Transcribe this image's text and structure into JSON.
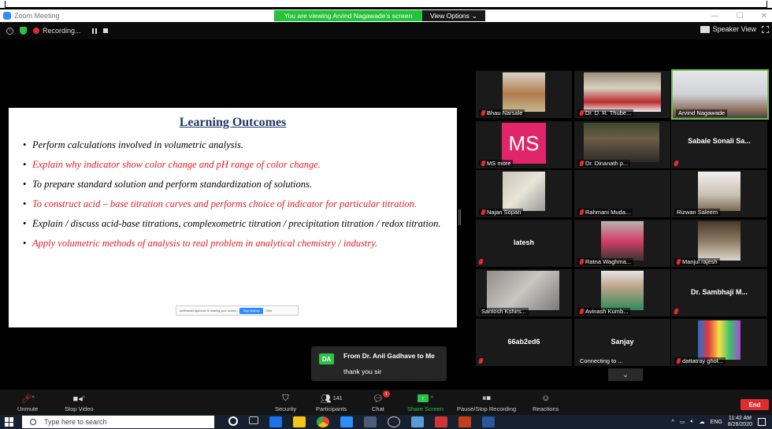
{
  "window": {
    "title": "Zoom Meeting",
    "banner": "You are viewing Arvind Nagawade's screen",
    "view_options": "View Options",
    "controls": [
      "—",
      "☐",
      "✕"
    ]
  },
  "meeting_top": {
    "recording": "Recording...",
    "speaker_view": "Speaker View"
  },
  "slide": {
    "title": "Learning Outcomes",
    "bullets": [
      {
        "text": "Perform calculations involved in volumetric analysis.",
        "color": "black"
      },
      {
        "text": "Explain why indicator show color change and pH range of color change.",
        "color": "red"
      },
      {
        "text": "To prepare standard solution  and  perform standardization of solutions.",
        "color": "black"
      },
      {
        "text": "To construct acid – base titration curves and performs choice of indicator for particular titration.",
        "color": "red"
      },
      {
        "text": "Explain / discuss acid-base titrations, complexometric titration / precipitation titration / redox titration.",
        "color": "black"
      },
      {
        "text": "Apply volumetric methods of analysis to real problem in analytical chemistry / industry.",
        "color": "red"
      }
    ],
    "share_bar": {
      "text": "anilkhande.ajamnun is sharing your screen",
      "stop": "Stop sharing",
      "hide": "Hide"
    }
  },
  "participants": [
    {
      "name": "Bhau Narsale",
      "type": "video"
    },
    {
      "name": "Dr. D. R. Thube...",
      "type": "video"
    },
    {
      "name": "Arvind Nagawade",
      "type": "video",
      "active": true
    },
    {
      "name": "MS more",
      "type": "initials",
      "initials": "MS"
    },
    {
      "name": "Dr. Dinanath p...",
      "type": "video"
    },
    {
      "name": "Sabale Sonali Sa...",
      "type": "text"
    },
    {
      "name": "Najan Sopan",
      "type": "video"
    },
    {
      "name": "Rahmani Muda...",
      "type": "blank"
    },
    {
      "name": "Rizwan Saleem",
      "type": "video"
    },
    {
      "name": "latesh",
      "type": "text"
    },
    {
      "name": "Ratna Waghma...",
      "type": "video"
    },
    {
      "name": "Manjul rajesh",
      "type": "video"
    },
    {
      "name": "Santosh Kshirs...",
      "type": "video"
    },
    {
      "name": "Avinash Kumb...",
      "type": "video"
    },
    {
      "name": "Dr. Sambhaji M...",
      "type": "text"
    },
    {
      "name": "66ab2ed6",
      "type": "text"
    },
    {
      "name": "Sanjay",
      "type": "text",
      "sub": "Connecting to ... "
    },
    {
      "name": "dattatray ghot...",
      "type": "video"
    }
  ],
  "chat_popup": {
    "avatar": "DA",
    "from": "From Dr. Anil Gadhave to Me",
    "message": "thank you sir"
  },
  "toolbar": {
    "unmute": "Unmute",
    "stop_video": "Stop Video",
    "security": "Security",
    "participants": "Participants",
    "participant_count": "141",
    "chat": "Chat",
    "chat_badge": "1",
    "share_screen": "Share Screen",
    "pause_recording": "Pause/Stop Recording",
    "reactions": "Reactions",
    "end": "End"
  },
  "taskbar": {
    "search_placeholder": "Type here to search",
    "language": "ENG",
    "time": "11:42 AM",
    "date": "8/26/2020"
  }
}
